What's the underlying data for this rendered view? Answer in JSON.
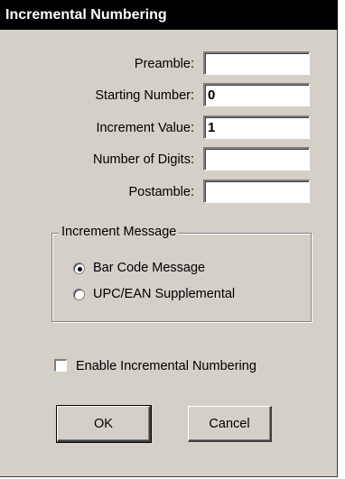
{
  "window": {
    "title": "Incremental Numbering"
  },
  "fields": {
    "preamble": {
      "label": "Preamble:",
      "value": ""
    },
    "starting_number": {
      "label": "Starting Number:",
      "value": "0"
    },
    "increment_value": {
      "label": "Increment Value:",
      "value": "1"
    },
    "number_of_digits": {
      "label": "Number of Digits:",
      "value": ""
    },
    "postamble": {
      "label": "Postamble:",
      "value": ""
    }
  },
  "increment_message": {
    "title": "Increment Message",
    "options": [
      {
        "label": "Bar Code Message",
        "selected": true
      },
      {
        "label": "UPC/EAN Supplemental",
        "selected": false
      }
    ]
  },
  "enable_checkbox": {
    "label": "Enable Incremental Numbering",
    "checked": false
  },
  "buttons": {
    "ok": "OK",
    "cancel": "Cancel"
  },
  "colors": {
    "dialog_face": "#d4d0c8",
    "titlebar": "#000000",
    "titlebar_text": "#ffffff",
    "input_background": "#ffffff"
  }
}
